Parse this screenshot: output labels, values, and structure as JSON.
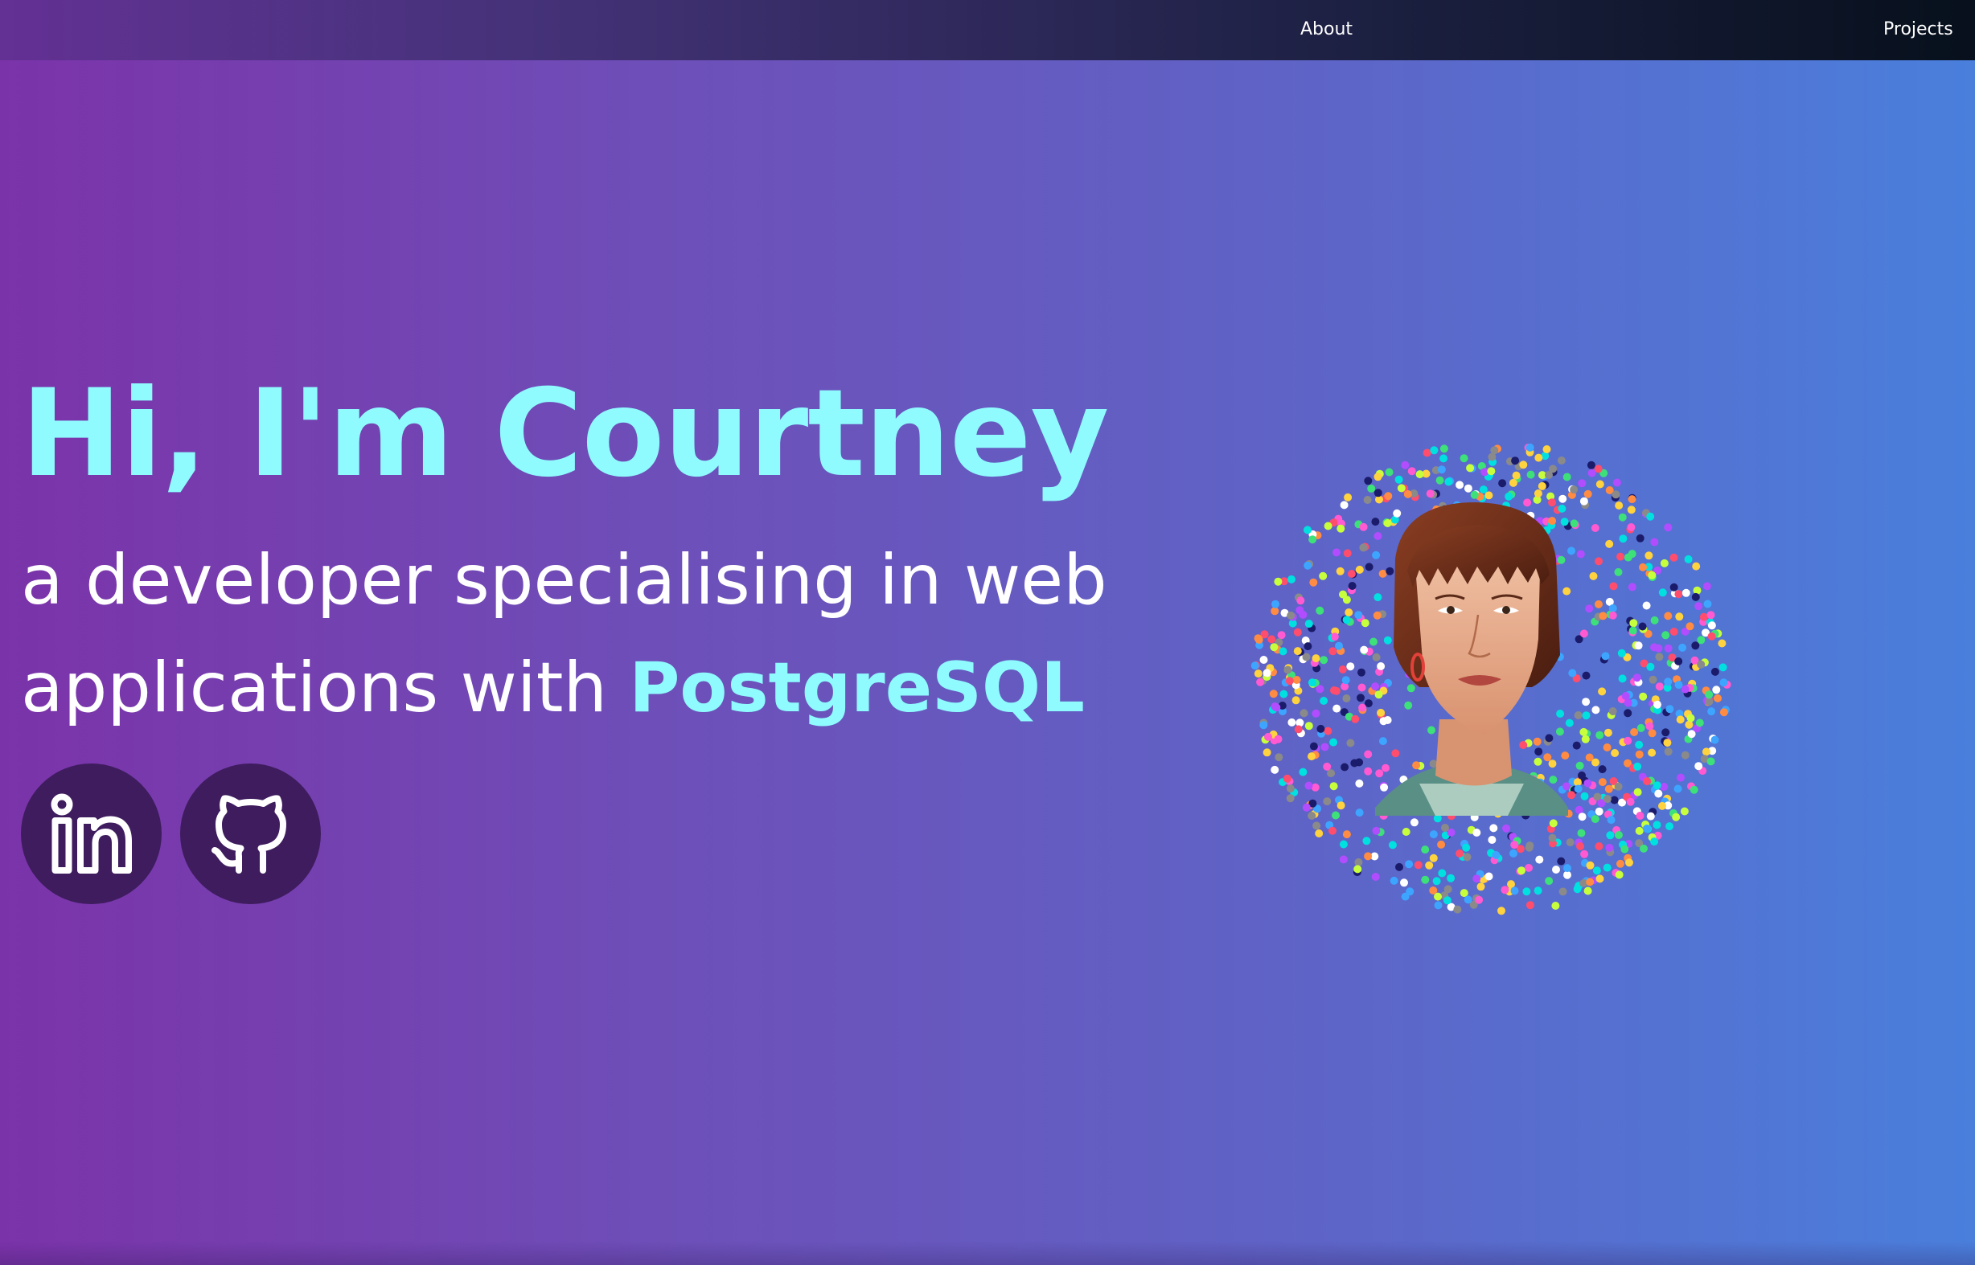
{
  "nav": {
    "about_label": "About",
    "projects_label": "Projects"
  },
  "hero": {
    "title": "Hi, I'm Courtney",
    "subtitle_prefix": "a developer specialising in web applications with",
    "subtitle_accent": "PostgreSQL"
  },
  "social": [
    {
      "icon": "linkedin-icon"
    },
    {
      "icon": "github-icon"
    }
  ],
  "colors": {
    "accent": "#8ffbff",
    "social_bg": "#3e1c5e",
    "text": "#ffffff"
  }
}
